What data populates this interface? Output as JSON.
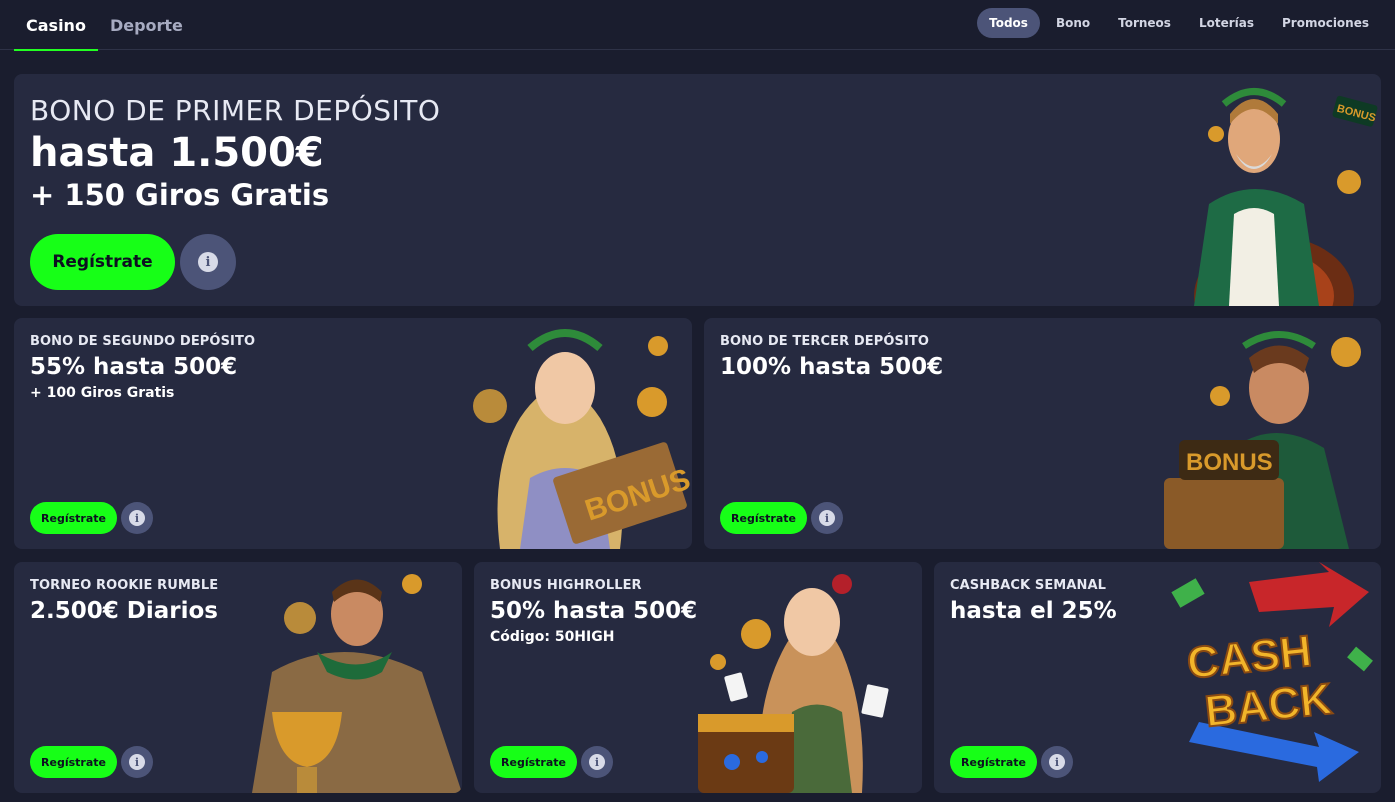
{
  "nav": {
    "tabs": [
      {
        "label": "Casino",
        "active": true
      },
      {
        "label": "Deporte",
        "active": false
      }
    ],
    "filters": [
      {
        "label": "Todos",
        "active": true
      },
      {
        "label": "Bono",
        "active": false
      },
      {
        "label": "Torneos",
        "active": false
      },
      {
        "label": "Loterías",
        "active": false
      },
      {
        "label": "Promociones",
        "active": false
      }
    ]
  },
  "promos": {
    "first_deposit": {
      "kicker": "BONO DE PRIMER DEPÓSITO",
      "headline": "hasta 1.500€",
      "sub": "+ 150 Giros Gratis",
      "cta": "Regístrate",
      "badge": "BONUS"
    },
    "second_deposit": {
      "kicker": "BONO DE SEGUNDO DEPÓSITO",
      "headline": "55% hasta 500€",
      "sub": "+ 100 Giros Gratis",
      "cta": "Regístrate",
      "badge": "BONUS"
    },
    "third_deposit": {
      "kicker": "BONO DE TERCER DEPÓSITO",
      "headline": "100% hasta 500€",
      "cta": "Regístrate",
      "badge": "BONUS"
    },
    "rookie_rumble": {
      "kicker": "TORNEO ROOKIE RUMBLE",
      "headline": "2.500€ Diarios",
      "cta": "Regístrate"
    },
    "highroller": {
      "kicker": "BONUS HIGHROLLER",
      "headline": "50% hasta 500€",
      "sub": "Código: 50HIGH",
      "cta": "Regístrate"
    },
    "cashback": {
      "kicker": "CASHBACK SEMANAL",
      "headline": "hasta el 25%",
      "cta": "Regístrate",
      "art_line1": "CASH",
      "art_line2": "BACK"
    }
  },
  "info_icon_glyph": "i",
  "colors": {
    "background": "#1a1d2e",
    "card": "#262a40",
    "accent_green": "#17ff17",
    "chip_active": "#4c5478",
    "gold": "#d99a2b"
  }
}
